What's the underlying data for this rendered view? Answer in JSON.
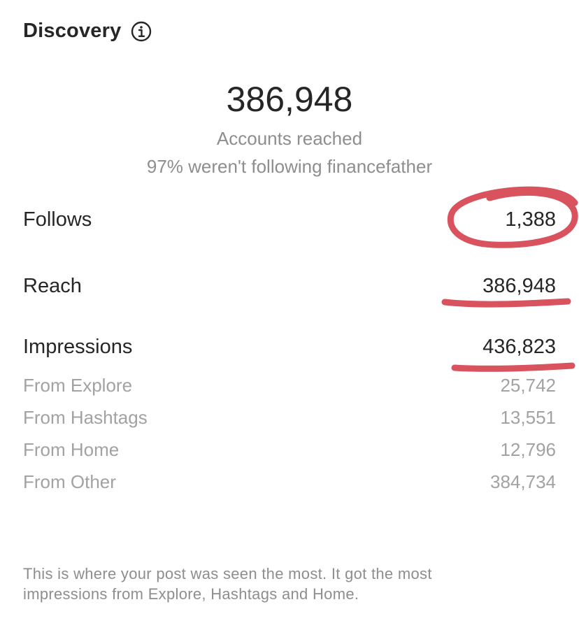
{
  "header": {
    "title": "Discovery",
    "info_icon": "info-circle-icon"
  },
  "summary": {
    "value": "386,948",
    "label": "Accounts reached",
    "subtext": "97% weren't following financefather"
  },
  "metrics": {
    "follows": {
      "label": "Follows",
      "value": "1,388"
    },
    "reach": {
      "label": "Reach",
      "value": "386,948"
    },
    "impressions": {
      "label": "Impressions",
      "value": "436,823"
    }
  },
  "breakdown": [
    {
      "label": "From Explore",
      "value": "25,742"
    },
    {
      "label": "From Hashtags",
      "value": "13,551"
    },
    {
      "label": "From Home",
      "value": "12,796"
    },
    {
      "label": "From Other",
      "value": "384,734"
    }
  ],
  "footer": {
    "line1": "This is where your post was seen the most. It got the most",
    "line2": "impressions from Explore, Hashtags and Home."
  },
  "colors": {
    "annotation": "#d9535e",
    "text": "#262626",
    "secondary": "#8e8e8e"
  }
}
